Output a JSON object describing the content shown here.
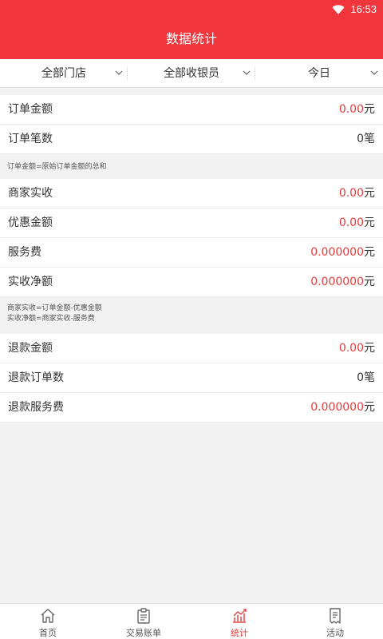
{
  "status_bar": {
    "time": "16:53",
    "wifi_icon": "wifi-icon"
  },
  "app_bar": {
    "title": "数据统计"
  },
  "filters": [
    {
      "label": "全部门店"
    },
    {
      "label": "全部收银员"
    },
    {
      "label": "今日"
    }
  ],
  "section1": {
    "rows": [
      {
        "label": "订单金额",
        "value": "0.00",
        "unit": "元"
      },
      {
        "label": "订单笔数",
        "value": "0",
        "unit": "笔"
      }
    ],
    "note_lines": [
      "订单金额=原始订单金额的总和"
    ]
  },
  "section2": {
    "rows": [
      {
        "label": "商家实收",
        "value": "0.00",
        "unit": "元"
      },
      {
        "label": "优惠金额",
        "value": "0.00",
        "unit": "元"
      },
      {
        "label": "服务费",
        "value": "0.000000",
        "unit": "元"
      },
      {
        "label": "实收净额",
        "value": "0.000000",
        "unit": "元"
      }
    ],
    "note_lines": [
      "商家实收=订单金额-优惠金额",
      "实收净额=商家实收-服务费"
    ]
  },
  "section3": {
    "rows": [
      {
        "label": "退款金额",
        "value": "0.00",
        "unit": "元"
      },
      {
        "label": "退款订单数",
        "value": "0",
        "unit": "笔"
      },
      {
        "label": "退款服务费",
        "value": "0.000000",
        "unit": "元"
      }
    ]
  },
  "tab_bar": {
    "active": "统计",
    "tabs": [
      {
        "label": "首页",
        "icon": "home-icon"
      },
      {
        "label": "交易账单",
        "icon": "clipboard-icon"
      },
      {
        "label": "统计",
        "icon": "chart-icon"
      },
      {
        "label": "活动",
        "icon": "receipt-icon"
      }
    ]
  },
  "colors": {
    "brand_red": "#f0353c",
    "value_red": "#e83a3a"
  }
}
